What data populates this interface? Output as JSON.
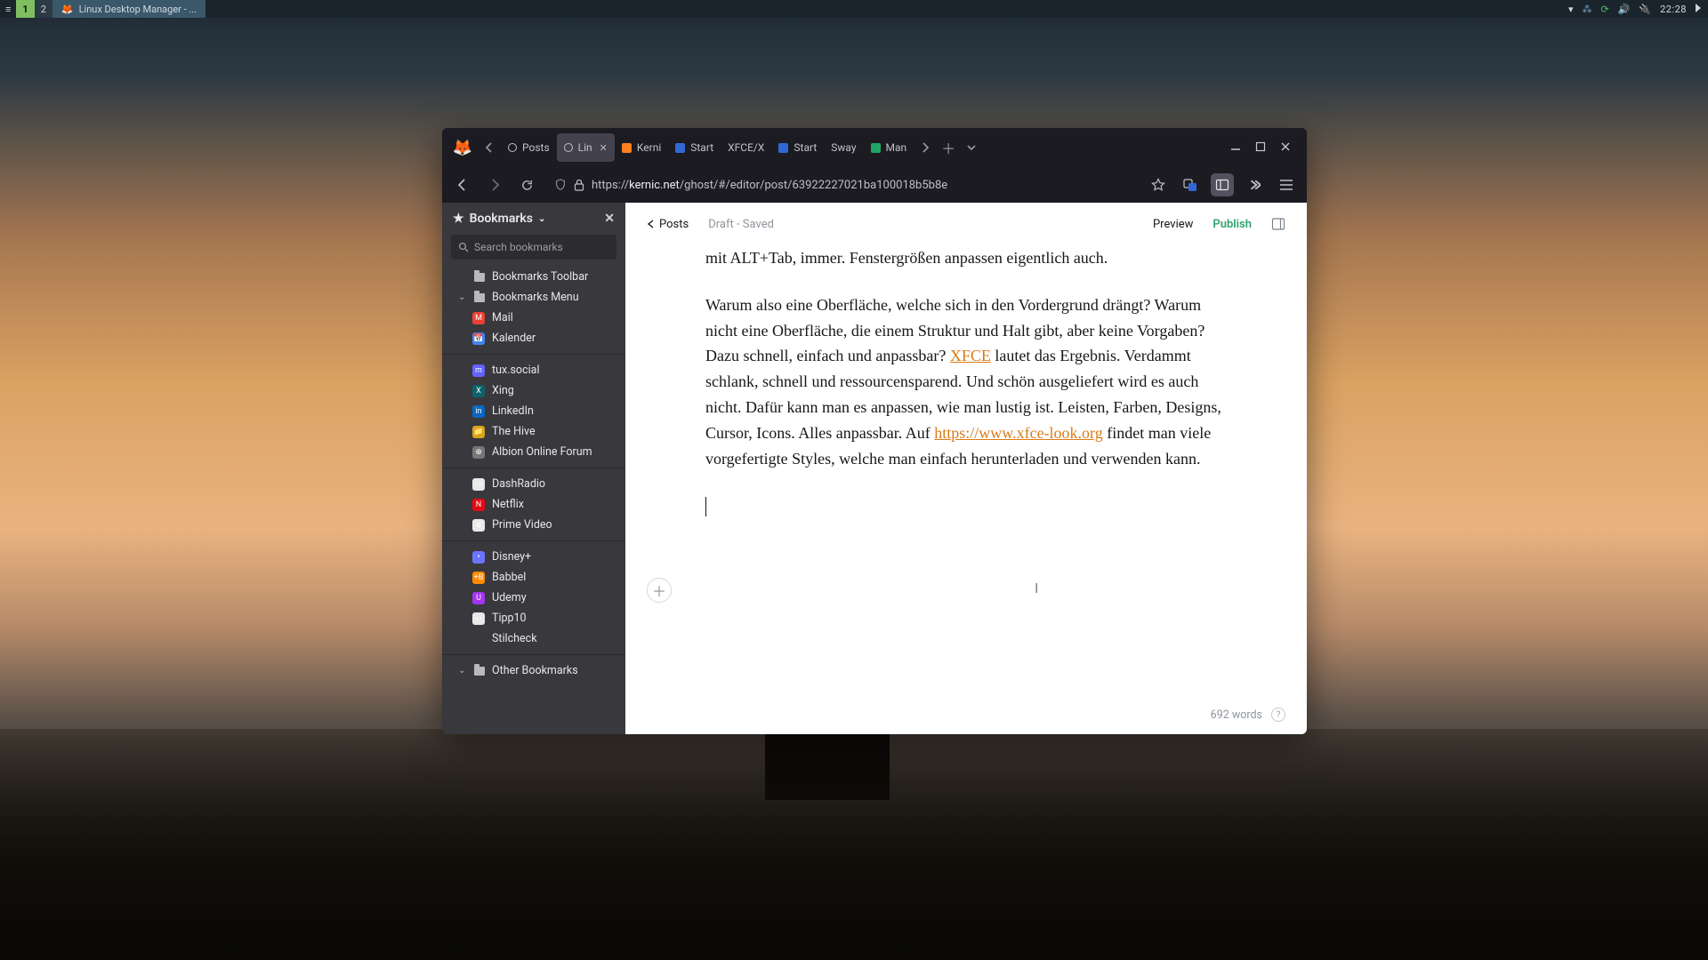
{
  "panel": {
    "workspaces": [
      "1",
      "2"
    ],
    "task": {
      "icon": "🦊",
      "title": "Linux Desktop Manager - ..."
    },
    "clock": "22:28"
  },
  "browser": {
    "tabs": [
      {
        "label": "Posts",
        "kind": "ghost"
      },
      {
        "label": "Lin",
        "kind": "ghost",
        "active": true,
        "closable": true
      },
      {
        "label": "Kerni",
        "kind": "k"
      },
      {
        "label": "Start",
        "kind": "b"
      },
      {
        "label": "XFCE/X",
        "kind": "text"
      },
      {
        "label": "Start",
        "kind": "b"
      },
      {
        "label": "Sway",
        "kind": "text"
      },
      {
        "label": "Man",
        "kind": "g"
      }
    ],
    "url": {
      "prefix": "https://",
      "host": "kernic.net",
      "rest": "/ghost/#/editor/post/63922227021ba100018b5b8e"
    }
  },
  "bookmarks": {
    "title": "Bookmarks",
    "search_ph": "Search bookmarks",
    "tree": [
      {
        "t": "folder",
        "label": "Bookmarks Toolbar"
      },
      {
        "t": "folder",
        "label": "Bookmarks Menu",
        "expanded": true,
        "children": [
          {
            "t": "group",
            "items": [
              {
                "label": "Mail",
                "color": "#ea4335",
                "sym": "M"
              },
              {
                "label": "Kalender",
                "color": "#4285f4",
                "sym": "📅"
              }
            ]
          },
          {
            "t": "group",
            "items": [
              {
                "label": "tux.social",
                "color": "#6364ff",
                "sym": "m"
              },
              {
                "label": "Xing",
                "color": "#0b646a",
                "sym": "X"
              },
              {
                "label": "LinkedIn",
                "color": "#0a66c2",
                "sym": "in"
              },
              {
                "label": "The Hive",
                "color": "#d8a31a",
                "sym": "📁"
              },
              {
                "label": "Albion Online Forum",
                "color": "#777",
                "sym": "⊕"
              }
            ]
          },
          {
            "t": "group",
            "items": [
              {
                "label": "DashRadio",
                "color": "#e8e8e8",
                "sym": "▭"
              },
              {
                "label": "Netflix",
                "color": "#e50914",
                "sym": "N"
              },
              {
                "label": "Prime Video",
                "color": "#eaeaea",
                "sym": "a"
              }
            ]
          },
          {
            "t": "group",
            "items": [
              {
                "label": "Disney+",
                "color": "#6b74ff",
                "sym": "•"
              },
              {
                "label": "Babbel",
                "color": "#ff8a00",
                "sym": "+B"
              },
              {
                "label": "Udemy",
                "color": "#a435f0",
                "sym": "U"
              },
              {
                "label": "Tipp10",
                "color": "#e8e8e8",
                "sym": "▭"
              },
              {
                "label": "Stilcheck",
                "color": "",
                "sym": ""
              }
            ]
          }
        ]
      },
      {
        "t": "folder",
        "label": "Other Bookmarks",
        "expanded": true
      }
    ]
  },
  "editor": {
    "back": "Posts",
    "status": "Draft - Saved",
    "preview": "Preview",
    "publish": "Publish",
    "para1": "mit ALT+Tab, immer. Fenstergrößen anpassen eigentlich auch.",
    "para2a": "Warum also eine Oberfläche, welche sich in den Vordergrund drängt? Warum nicht eine Oberfläche, die einem Struktur und Halt gibt, aber keine Vorgaben? Dazu schnell, einfach und anpassbar? ",
    "link1": "XFCE",
    "para2b": " lautet das Ergebnis. Verdammt schlank, schnell und ressourcensparend. Und schön ausgeliefert wird es auch nicht. Dafür kann man es anpassen, wie man lustig ist. Leisten, Farben, Designs, Cursor, Icons. Alles anpassbar. Auf ",
    "link2": "https://www.xfce-look.org",
    "para2c": " findet man viele vorgefertigte Styles, welche man einfach herunterladen und verwenden kann.",
    "wordcount": "692 words"
  }
}
